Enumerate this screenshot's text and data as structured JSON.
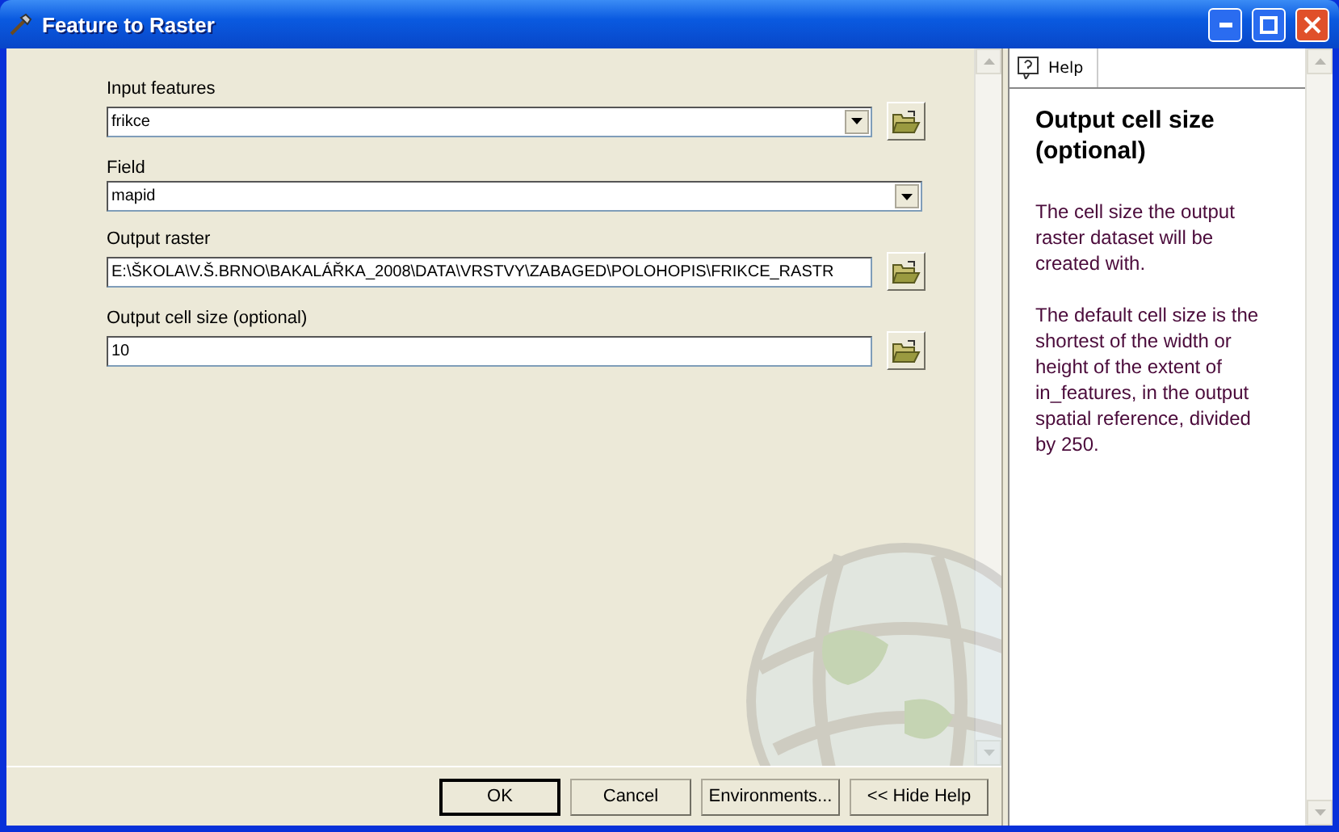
{
  "window": {
    "title": "Feature to Raster"
  },
  "parameters": [
    {
      "label": "Input features",
      "value": "frikce",
      "dropdown": true,
      "browse": true
    },
    {
      "label": "Field",
      "value": "mapid",
      "dropdown": true,
      "browse": false
    },
    {
      "label": "Output raster",
      "value": "E:\\ŠKOLA\\V.Š.BRNO\\BAKALÁŘKA_2008\\DATA\\VRSTVY\\ZABAGED\\POLOHOPIS\\FRIKCE_RASTR",
      "dropdown": false,
      "browse": true
    },
    {
      "label": "Output cell size (optional)",
      "value": "10",
      "dropdown": false,
      "browse": true
    }
  ],
  "buttons": [
    {
      "label": "OK",
      "default": true
    },
    {
      "label": "Cancel",
      "default": false
    },
    {
      "label": "Environments...",
      "default": false
    },
    {
      "label": "<< Hide Help",
      "default": false
    }
  ],
  "help": {
    "tab": "Help",
    "title": "Output cell size (optional)",
    "paragraphs": [
      "The cell size the output raster dataset will be created with.",
      "The default cell size is the shortest of the width or height of the extent of in_features, in the output spatial reference, divided by 250."
    ]
  }
}
